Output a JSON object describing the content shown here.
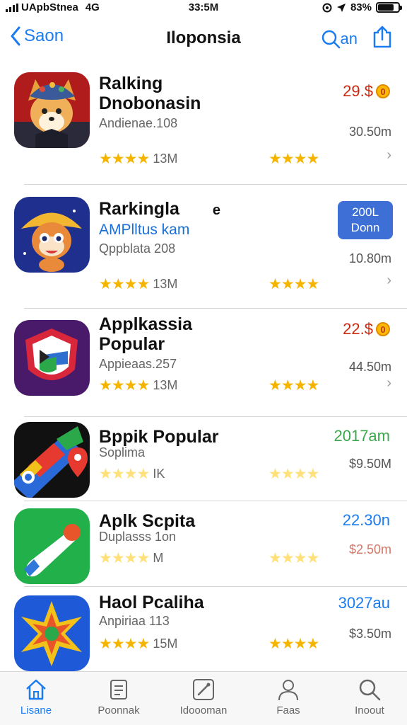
{
  "status": {
    "carrier": "UApbStnea",
    "network": "4G",
    "time": "33:5M",
    "battery": "83%",
    "battery_level": 0.83
  },
  "nav": {
    "back_label": "Saon",
    "title": "Iloponsia",
    "search_text": "an"
  },
  "apps": [
    {
      "title_line1": "Ralking",
      "title_line2": "Dnobonasin",
      "subtitle": "Andienae.108",
      "price": "29.$",
      "coin": "0",
      "size": "30.50m",
      "review_count": "13M",
      "rating": 3.5,
      "rating2": 4,
      "chevron": "›"
    },
    {
      "title_line1": "Rarkingla",
      "title_mark": "e",
      "subtitle_blue": "AMPlltus kam",
      "subtitle": "Qppblata 208",
      "button_line1": "200L",
      "button_line2": "Donn",
      "size": "10.80m",
      "review_count": "13M",
      "rating": 4,
      "rating2": 4,
      "chevron": "›"
    },
    {
      "title_line1": "Applkassia",
      "title_line2": "Popular",
      "subtitle": "Appieaas.257",
      "price": "22.$",
      "coin": "0",
      "size": "44.50m",
      "review_count": "13M",
      "rating": 4,
      "rating2": 4,
      "chevron": "›"
    },
    {
      "title_line1": "Bppik Popular",
      "subtitle": "Soplima",
      "price": "2017am",
      "size": "$9.50M",
      "review_count": "IK",
      "rating": 4,
      "rating2": 4
    },
    {
      "title_line1": "Aplk Scpita",
      "subtitle": "Duplasss 1on",
      "price": "22.30n",
      "size": "$2.50m",
      "review_count": "M",
      "rating": 4,
      "rating2": 4
    },
    {
      "title_line1": "Haol Pcaliha",
      "subtitle": "Anpiriaa 113",
      "price": "3027au",
      "size": "$3.50m",
      "review_count": "15M",
      "rating": 4,
      "rating2": 4
    }
  ],
  "tabs": [
    {
      "label": "Lisane",
      "icon": "home-icon"
    },
    {
      "label": "Poonnak",
      "icon": "apps-icon"
    },
    {
      "label": "Idoooman",
      "icon": "games-icon"
    },
    {
      "label": "Faas",
      "icon": "person-icon"
    },
    {
      "label": "Inoout",
      "icon": "search-icon"
    }
  ],
  "colors": {
    "accent": "#1a7cf0",
    "star": "#f5b400",
    "price_red": "#cc2a10",
    "price_green": "#3aa84a",
    "price_blue": "#1a7cf0",
    "button": "#3d6fd6"
  }
}
